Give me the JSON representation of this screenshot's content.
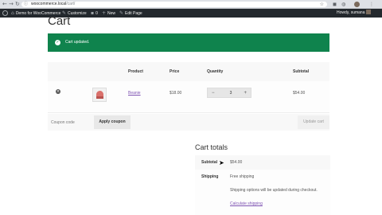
{
  "browser": {
    "url_host": "woocommerce.local",
    "url_path": "/cart/",
    "back_icon": "arrow-left-icon",
    "forward_icon": "arrow-right-icon",
    "reload_icon": "reload-icon"
  },
  "adminbar": {
    "site_name": "Demo for WooCommerce",
    "customize": "Customize",
    "comments_count": "0",
    "new_label": "New",
    "edit_label": "Edit Page",
    "howdy": "Howdy, sumana"
  },
  "page": {
    "title": "Cart",
    "notice": "Cart updated."
  },
  "cart": {
    "headers": {
      "product": "Product",
      "price": "Price",
      "quantity": "Quantity",
      "subtotal": "Subtotal"
    },
    "items": [
      {
        "name": "Beanie",
        "price": "$18.00",
        "quantity": "3",
        "subtotal": "$54.00"
      }
    ],
    "coupon_placeholder": "Coupon code",
    "apply_coupon": "Apply coupon",
    "update_cart": "Update cart"
  },
  "totals": {
    "title": "Cart totals",
    "subtotal_label": "Subtotal",
    "subtotal_value": "$54.00",
    "shipping_label": "Shipping",
    "shipping_method": "Free shipping",
    "shipping_note": "Shipping options will be updated during checkout.",
    "calc_link": "Calculate shipping"
  }
}
